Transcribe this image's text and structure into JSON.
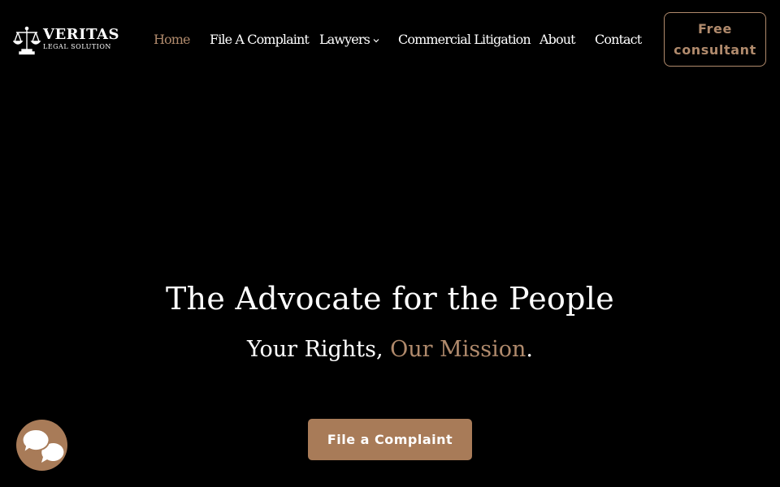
{
  "brand": {
    "name": "VERITAS",
    "tagline": "LEGAL SOLUTION",
    "logo_icon": "scales-of-justice-icon"
  },
  "nav": {
    "items": [
      {
        "label": "Home",
        "active": true
      },
      {
        "label": "File A Complaint"
      },
      {
        "label": "Lawyers",
        "dropdown": true
      },
      {
        "label": "Commercial Litigation"
      },
      {
        "label": "About"
      },
      {
        "label": "Contact"
      }
    ],
    "cta_line1": "Free",
    "cta_line2": "consultant"
  },
  "hero": {
    "title": "The Advocate for the People",
    "subtitle_lead": "Your Rights, ",
    "subtitle_accent": "Our Mission",
    "subtitle_end": ".",
    "button_label": "File a Complaint"
  },
  "chat": {
    "icon": "chat-bubbles-icon"
  },
  "colors": {
    "background": "#000000",
    "accent": "#b08a6c",
    "button": "#a87b58",
    "text": "#ffffff"
  }
}
